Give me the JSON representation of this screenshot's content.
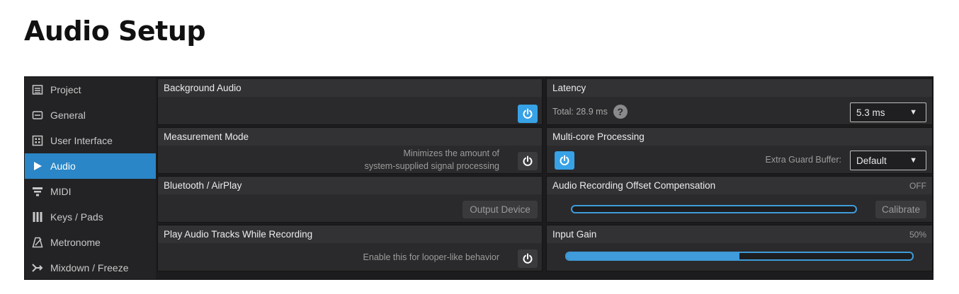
{
  "page": {
    "title": "Audio Setup"
  },
  "sidebar": {
    "items": [
      {
        "label": "Project",
        "icon": "project-icon",
        "active": false
      },
      {
        "label": "General",
        "icon": "general-icon",
        "active": false
      },
      {
        "label": "User Interface",
        "icon": "user-interface-icon",
        "active": false
      },
      {
        "label": "Audio",
        "icon": "audio-play-icon",
        "active": true
      },
      {
        "label": "MIDI",
        "icon": "midi-icon",
        "active": false
      },
      {
        "label": "Keys / Pads",
        "icon": "keys-pads-icon",
        "active": false
      },
      {
        "label": "Metronome",
        "icon": "metronome-icon",
        "active": false
      },
      {
        "label": "Mixdown / Freeze",
        "icon": "mixdown-icon",
        "active": false
      }
    ]
  },
  "panels": {
    "background_audio": {
      "title": "Background Audio",
      "power_on": true
    },
    "measurement_mode": {
      "title": "Measurement Mode",
      "desc_line1": "Minimizes the amount of",
      "desc_line2": "system-supplied signal processing",
      "power_on": false
    },
    "bluetooth": {
      "title": "Bluetooth / AirPlay",
      "button_label": "Output Device"
    },
    "play_audio": {
      "title": "Play Audio Tracks While Recording",
      "desc": "Enable this for looper-like behavior",
      "power_on": false
    },
    "latency": {
      "title": "Latency",
      "total_label": "Total: 28.9 ms",
      "select_value": "5.3 ms"
    },
    "multicore": {
      "title": "Multi-core Processing",
      "power_on": true,
      "guard_label": "Extra Guard Buffer:",
      "guard_value": "Default"
    },
    "offset": {
      "title": "Audio Recording Offset Compensation",
      "status": "OFF",
      "fill": 0,
      "button_label": "Calibrate"
    },
    "input_gain": {
      "title": "Input Gain",
      "value_label": "50%",
      "fill": 0.5
    }
  },
  "colors": {
    "accent": "#37a2e6",
    "active_sidebar": "#2a86c7"
  }
}
